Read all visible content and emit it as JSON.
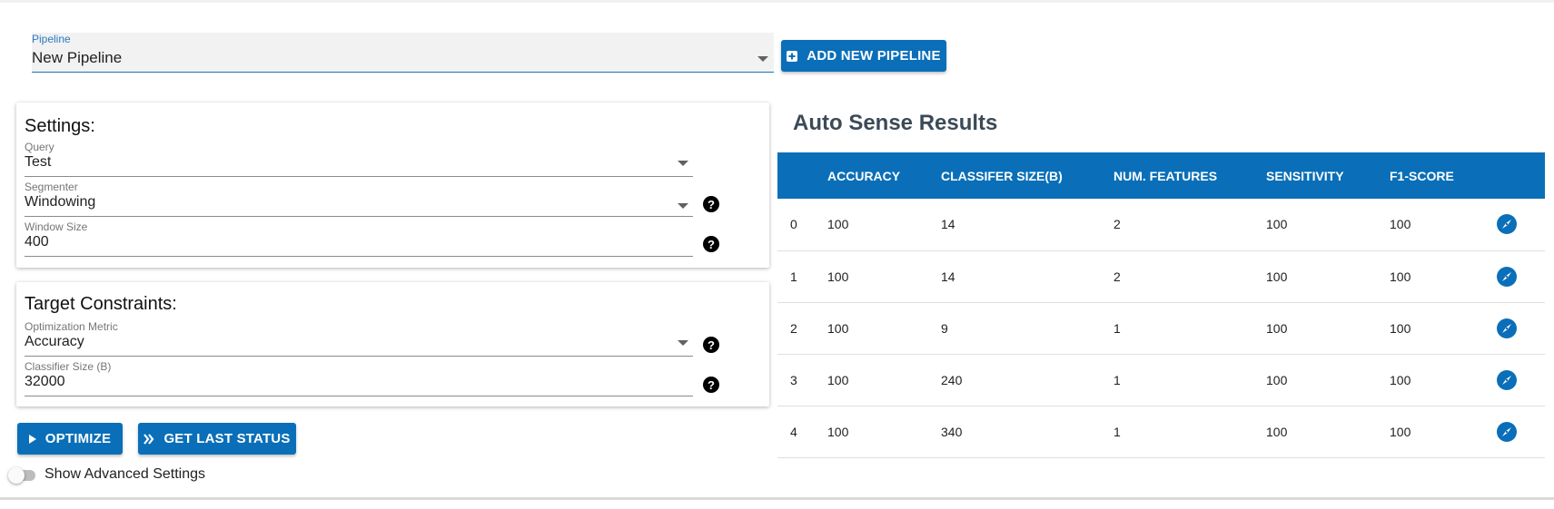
{
  "pipeline": {
    "label": "Pipeline",
    "value": "New Pipeline",
    "add_button_label": "ADD NEW PIPELINE"
  },
  "settings": {
    "title": "Settings:",
    "query": {
      "label": "Query",
      "value": "Test"
    },
    "segmenter": {
      "label": "Segmenter",
      "value": "Windowing"
    },
    "window_size": {
      "label": "Window Size",
      "value": "400"
    }
  },
  "constraints": {
    "title": "Target Constraints:",
    "metric": {
      "label": "Optimization Metric",
      "value": "Accuracy"
    },
    "classifier_size": {
      "label": "Classifier Size (B)",
      "value": "32000"
    }
  },
  "actions": {
    "optimize_label": "OPTIMIZE",
    "status_label": "GET LAST STATUS",
    "advanced_label": "Show Advanced Settings"
  },
  "results": {
    "title": "Auto Sense Results",
    "columns": [
      "",
      "ACCURACY",
      "CLASSIFER SIZE(B)",
      "NUM. FEATURES",
      "SENSITIVITY",
      "F1-SCORE",
      ""
    ],
    "rows": [
      [
        "0",
        "100",
        "14",
        "2",
        "100",
        "100"
      ],
      [
        "1",
        "100",
        "14",
        "2",
        "100",
        "100"
      ],
      [
        "2",
        "100",
        "9",
        "1",
        "100",
        "100"
      ],
      [
        "3",
        "100",
        "240",
        "1",
        "100",
        "100"
      ],
      [
        "4",
        "100",
        "340",
        "1",
        "100",
        "100"
      ]
    ]
  },
  "icons": {
    "add": "plus-square-icon",
    "optimize": "play-icon",
    "status": "double-chevron-right-icon",
    "row_action": "compass-icon",
    "help": "help-circle-icon"
  },
  "colors": {
    "accent": "#0a6fb8",
    "title": "#3c4a57"
  }
}
